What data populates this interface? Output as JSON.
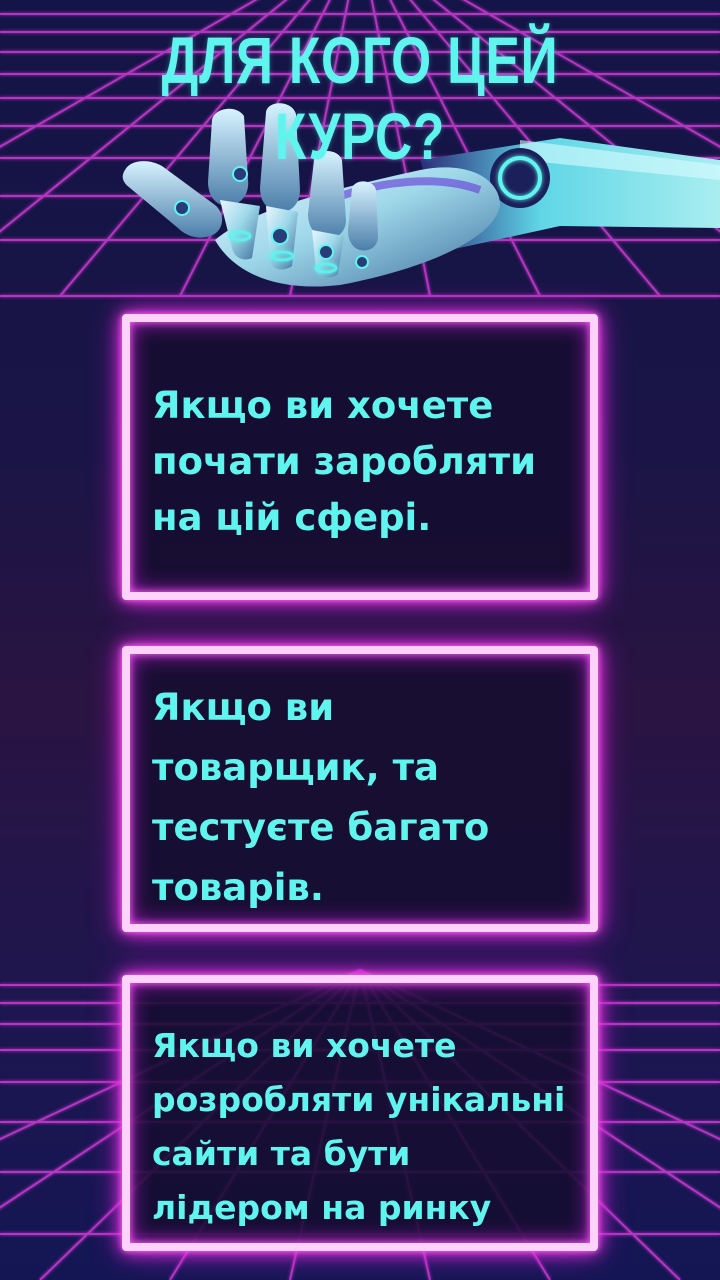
{
  "title": "ДЛЯ КОГО ЦЕЙ КУРС?",
  "colors": {
    "accent_text": "#5ff5ee",
    "neon_frame": "#ffd2fb",
    "neon_glow": "#f33ce6",
    "grid": "#d23bd6",
    "background": "#1a1546"
  },
  "illustration": {
    "icon": "robot-hand-icon"
  },
  "cards": [
    {
      "lines": [
        "Якщо ви хочете",
        "почати заробляти",
        "на цій сфері."
      ]
    },
    {
      "lines": [
        "Якщо ви",
        "товарщик, та",
        "тестуєте багато",
        "товарів."
      ]
    },
    {
      "lines": [
        "Якщо ви хочете",
        "розробляти унікальні",
        "сайти та бути",
        "лідером на ринку"
      ]
    }
  ]
}
